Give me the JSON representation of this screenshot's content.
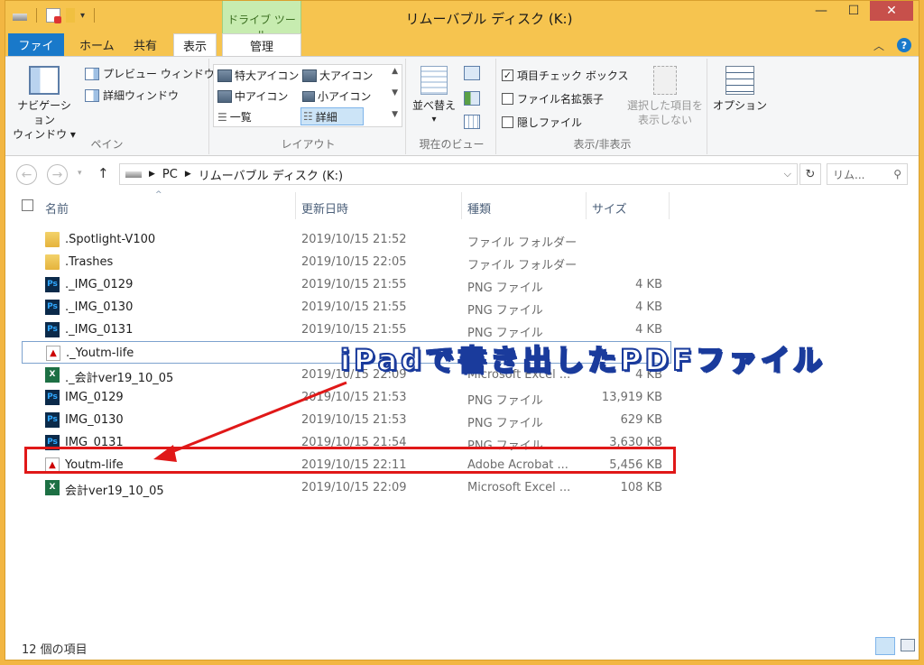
{
  "window": {
    "title": "リムーバブル ディスク (K:)",
    "context_tab_group": "ドライブ ツール"
  },
  "tabs": {
    "file": "ファイル",
    "home": "ホーム",
    "share": "共有",
    "view": "表示",
    "manage": "管理"
  },
  "ribbon": {
    "pane": {
      "nav_pane_line1": "ナビゲーション",
      "nav_pane_line2": "ウィンドウ",
      "preview_pane": "プレビュー ウィンドウ",
      "details_pane": "詳細ウィンドウ",
      "label": "ペイン"
    },
    "layout": {
      "extra_large": "特大アイコン",
      "large": "大アイコン",
      "medium": "中アイコン",
      "small": "小アイコン",
      "list": "一覧",
      "details": "詳細",
      "label": "レイアウト"
    },
    "current_view": {
      "sort": "並べ替え",
      "label": "現在のビュー"
    },
    "show_hide": {
      "item_checkboxes": "項目チェック ボックス",
      "file_extensions": "ファイル名拡張子",
      "hidden_items": "隠しファイル",
      "hide_selected_line1": "選択した項目を",
      "hide_selected_line2": "表示しない",
      "label": "表示/非表示"
    },
    "options": "オプション"
  },
  "address": {
    "root": "PC",
    "location": "リムーバブル ディスク (K:)"
  },
  "search": {
    "placeholder": "リム..."
  },
  "columns": {
    "name": "名前",
    "date": "更新日時",
    "type": "種類",
    "size": "サイズ"
  },
  "files": [
    {
      "name": ".Spotlight-V100",
      "date": "2019/10/15 21:52",
      "type": "ファイル フォルダー",
      "size": "",
      "icon": "folder"
    },
    {
      "name": ".Trashes",
      "date": "2019/10/15 22:05",
      "type": "ファイル フォルダー",
      "size": "",
      "icon": "folder"
    },
    {
      "name": "._IMG_0129",
      "date": "2019/10/15 21:55",
      "type": "PNG ファイル",
      "size": "4 KB",
      "icon": "ps"
    },
    {
      "name": "._IMG_0130",
      "date": "2019/10/15 21:55",
      "type": "PNG ファイル",
      "size": "4 KB",
      "icon": "ps"
    },
    {
      "name": "._IMG_0131",
      "date": "2019/10/15 21:55",
      "type": "PNG ファイル",
      "size": "4 KB",
      "icon": "ps"
    },
    {
      "name": "._Youtm-life",
      "date": "",
      "type": "Ad",
      "size": "",
      "icon": "pdf"
    },
    {
      "name": "._会計ver19_10_05",
      "date": "2019/10/15 22:09",
      "type": "Microsoft Excel ...",
      "size": "4 KB",
      "icon": "xls"
    },
    {
      "name": "IMG_0129",
      "date": "2019/10/15 21:53",
      "type": "PNG ファイル",
      "size": "13,919 KB",
      "icon": "ps"
    },
    {
      "name": "IMG_0130",
      "date": "2019/10/15 21:53",
      "type": "PNG ファイル",
      "size": "629 KB",
      "icon": "ps"
    },
    {
      "name": "IMG_0131",
      "date": "2019/10/15 21:54",
      "type": "PNG ファイル",
      "size": "3,630 KB",
      "icon": "ps"
    },
    {
      "name": "Youtm-life",
      "date": "2019/10/15 22:11",
      "type": "Adobe Acrobat ...",
      "size": "5,456 KB",
      "icon": "pdf"
    },
    {
      "name": "会計ver19_10_05",
      "date": "2019/10/15 22:09",
      "type": "Microsoft Excel ...",
      "size": "108 KB",
      "icon": "xls"
    }
  ],
  "status": {
    "count": "12 個の項目"
  },
  "annotation": {
    "text": "iPadで書き出したPDFファイル",
    "color": "#e01818"
  }
}
